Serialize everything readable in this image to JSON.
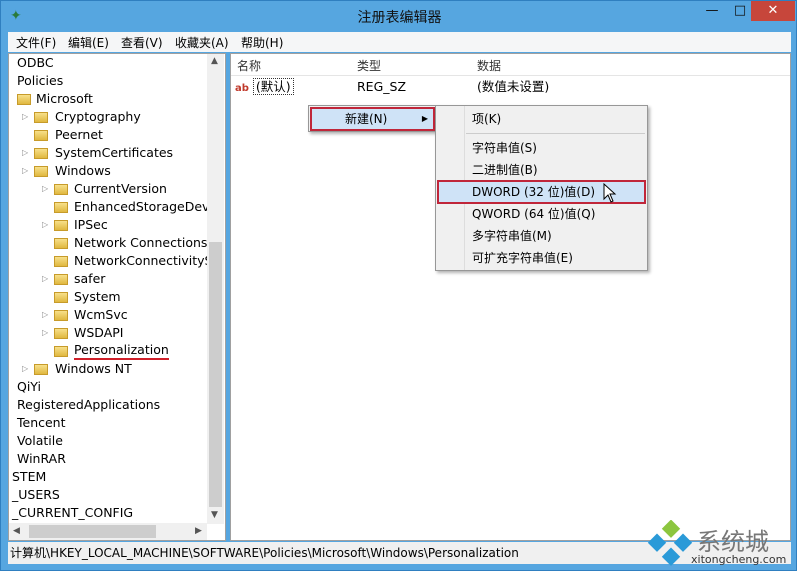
{
  "window": {
    "title": "注册表编辑器",
    "min": "—",
    "max": "□",
    "close": "✕",
    "icon": "regedit-icon"
  },
  "menubar": [
    "文件(F)",
    "编辑(E)",
    "查看(V)",
    "收藏夹(A)",
    "帮助(H)"
  ],
  "tree": [
    {
      "label": "ODBC",
      "level": 0,
      "folder": false,
      "exp": false
    },
    {
      "label": "Policies",
      "level": 0,
      "folder": false,
      "exp": false
    },
    {
      "label": "Microsoft",
      "level": 1,
      "folder": true,
      "exp": false
    },
    {
      "label": "Cryptography",
      "level": 2,
      "folder": true,
      "exp": true
    },
    {
      "label": "Peernet",
      "level": 2,
      "folder": true,
      "exp": false
    },
    {
      "label": "SystemCertificates",
      "level": 2,
      "folder": true,
      "exp": true
    },
    {
      "label": "Windows",
      "level": 2,
      "folder": true,
      "exp": true
    },
    {
      "label": "CurrentVersion",
      "level": 3,
      "folder": true,
      "exp": true
    },
    {
      "label": "EnhancedStorageDevic",
      "level": 3,
      "folder": true,
      "exp": false
    },
    {
      "label": "IPSec",
      "level": 3,
      "folder": true,
      "exp": true
    },
    {
      "label": "Network Connections",
      "level": 3,
      "folder": true,
      "exp": false
    },
    {
      "label": "NetworkConnectivitySta",
      "level": 3,
      "folder": true,
      "exp": false
    },
    {
      "label": "safer",
      "level": 3,
      "folder": true,
      "exp": true
    },
    {
      "label": "System",
      "level": 3,
      "folder": true,
      "exp": false
    },
    {
      "label": "WcmSvc",
      "level": 3,
      "folder": true,
      "exp": true
    },
    {
      "label": "WSDAPI",
      "level": 3,
      "folder": true,
      "exp": true
    },
    {
      "label": "Personalization",
      "level": 3,
      "folder": true,
      "exp": false,
      "selected": true
    },
    {
      "label": "Windows NT",
      "level": 2,
      "folder": true,
      "exp": true
    },
    {
      "label": "QiYi",
      "level": 0,
      "folder": false,
      "exp": false
    },
    {
      "label": "RegisteredApplications",
      "level": 0,
      "folder": false,
      "exp": false
    },
    {
      "label": "Tencent",
      "level": 0,
      "folder": false,
      "exp": false
    },
    {
      "label": "Volatile",
      "level": 0,
      "folder": false,
      "exp": false
    },
    {
      "label": "WinRAR",
      "level": 0,
      "folder": false,
      "exp": false
    },
    {
      "label": "STEM",
      "level": -1,
      "folder": false,
      "exp": false
    },
    {
      "label": "_USERS",
      "level": -1,
      "folder": false,
      "exp": false
    },
    {
      "label": "_CURRENT_CONFIG",
      "level": -1,
      "folder": false,
      "exp": false
    }
  ],
  "list": {
    "headers": [
      "名称",
      "类型",
      "数据"
    ],
    "rows": [
      {
        "name": "(默认)",
        "type": "REG_SZ",
        "data": "(数值未设置)",
        "icon": "ab"
      }
    ]
  },
  "context_menu": {
    "new": "新建(N)"
  },
  "submenu": [
    "项(K)",
    "字符串值(S)",
    "二进制值(B)",
    "DWORD (32 位)值(D)",
    "QWORD (64 位)值(Q)",
    "多字符串值(M)",
    "可扩充字符串值(E)"
  ],
  "status": "计算机\\HKEY_LOCAL_MACHINE\\SOFTWARE\\Policies\\Microsoft\\Windows\\Personalization",
  "watermark": {
    "text": "系统城",
    "url": "xitongcheng.com"
  }
}
